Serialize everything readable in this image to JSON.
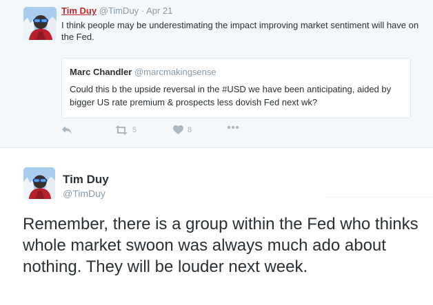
{
  "quoted_tweet": {
    "author_name": "Tim Duy",
    "author_handle": "@TimDuy",
    "separator": "·",
    "date": "Apr 21",
    "text": "I think people may be underestimating the impact improving market sentiment will have on the Fed.",
    "embedded_quote": {
      "author_name": "Marc Chandler",
      "author_handle": "@marcmakingsense",
      "text": "Could this b the upside reversal in the #USD we have been anticipating, aided by bigger US rate premium & prospects less dovish Fed next wk?"
    },
    "actions": {
      "reply_icon": "reply-icon",
      "retweet_icon": "retweet-icon",
      "retweet_count": "5",
      "like_icon": "heart-icon",
      "like_count": "8",
      "more_icon": "more-icon"
    }
  },
  "main_tweet": {
    "author_name": "Tim Duy",
    "author_handle": "@TimDuy",
    "text": "Remember, there is a group within the Fed who thinks whole market swoon was always much ado about nothing. They will be louder next week."
  },
  "colors": {
    "link_red": "#c1272d",
    "muted": "#8899a6",
    "icon_gray": "#aab8c2",
    "text": "#292f33",
    "quoted_bg": "#f5f8fa"
  }
}
